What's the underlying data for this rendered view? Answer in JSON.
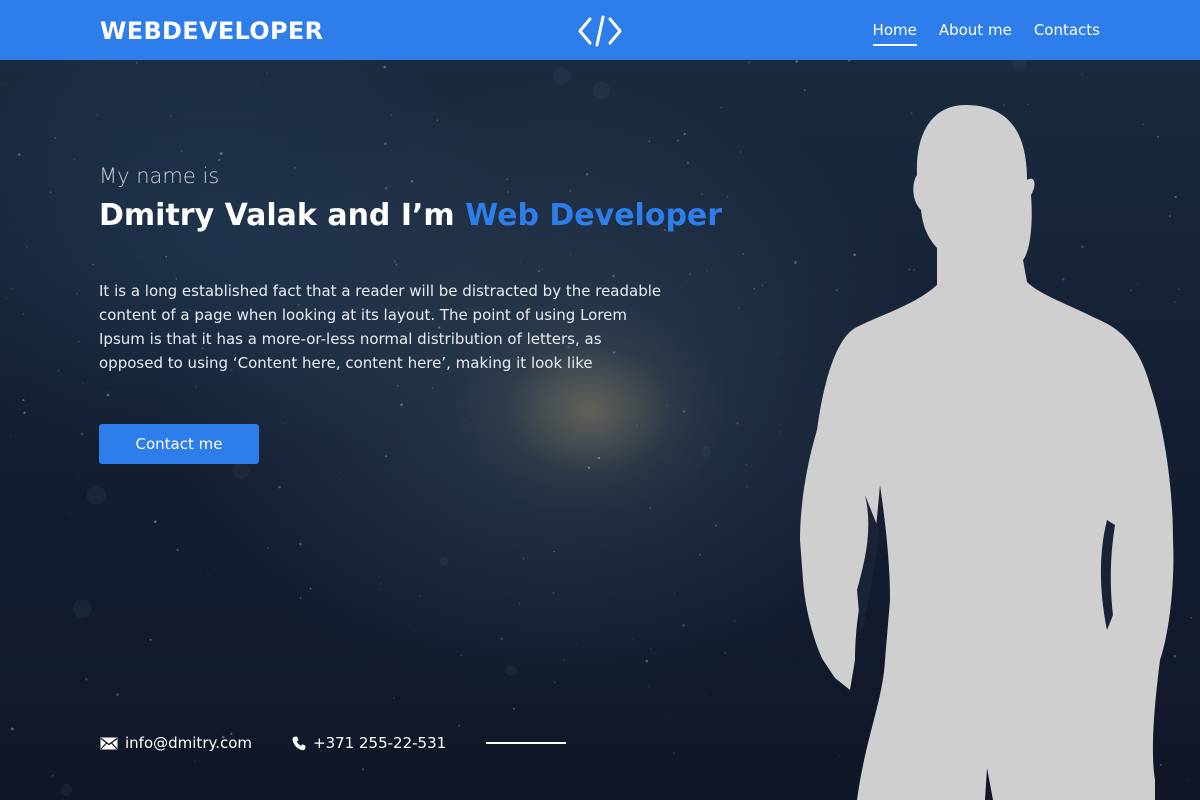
{
  "header": {
    "brand": "WEBDEVELOPER",
    "logo_icon": "code-brackets-icon",
    "nav": [
      {
        "label": "Home",
        "active": true
      },
      {
        "label": "About me",
        "active": false
      },
      {
        "label": "Contacts",
        "active": false
      }
    ]
  },
  "hero": {
    "intro": "My name is",
    "headline_main": "Dmitry Valak and I’m ",
    "headline_accent": "Web Developer",
    "bio": "It is a long established fact that a reader will be distracted by the readable content of a page when looking at its layout. The point of using Lorem Ipsum is that it has a more-or-less normal distribution of letters, as opposed to using ‘Content here, content here’, making it look like",
    "cta_label": "Contact me"
  },
  "contacts": {
    "email": "info@dmitry.com",
    "email_icon": "envelope-icon",
    "phone": "+371 255-22-531",
    "phone_icon": "phone-icon"
  },
  "colors": {
    "accent": "#2d7dea",
    "header_bg": "#2d7dea",
    "silhouette": "#cfcfcf"
  }
}
